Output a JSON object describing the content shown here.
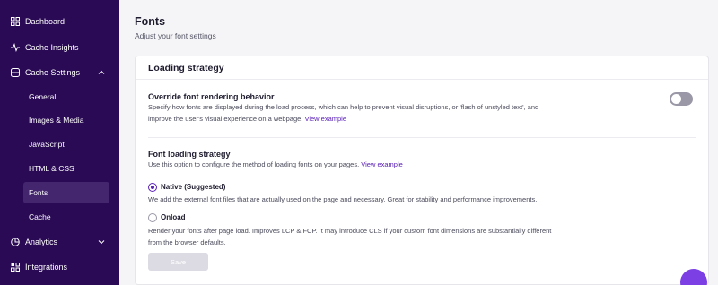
{
  "sidebar": {
    "items": [
      {
        "label": "Dashboard",
        "icon": "home-icon"
      },
      {
        "label": "Cache Insights",
        "icon": "activity-icon"
      },
      {
        "label": "Cache Settings",
        "icon": "database-icon",
        "expanded": true
      },
      {
        "label": "Analytics",
        "icon": "chart-icon",
        "expanded": false
      },
      {
        "label": "Integrations",
        "icon": "grid-icon"
      }
    ],
    "sub_items": [
      {
        "label": "General"
      },
      {
        "label": "Images & Media"
      },
      {
        "label": "JavaScript"
      },
      {
        "label": "HTML & CSS"
      },
      {
        "label": "Fonts",
        "active": true
      },
      {
        "label": "Cache"
      }
    ]
  },
  "header": {
    "title": "Fonts",
    "subtitle": "Adjust your font settings"
  },
  "card": {
    "title": "Loading strategy",
    "override": {
      "title": "Override font rendering behavior",
      "desc_line1": "Specify how fonts are displayed during the load process, which can help to prevent visual disruptions, or 'flash of unstyled text', and",
      "desc_line2": "improve the user's visual experience on a webpage.",
      "link": "View example",
      "toggle_on": false
    },
    "strategy": {
      "title": "Font loading strategy",
      "desc": "Use this option to configure the method of loading fonts on your pages.",
      "link": "View example",
      "options": [
        {
          "label": "Native (Suggested)",
          "checked": true,
          "desc_line1": "We add the external font files that are actually used on the page and necessary. Great for stability and performance improvements.",
          "desc_line2": ""
        },
        {
          "label": "Onload",
          "checked": false,
          "desc_line1": "Render your fonts after page load. Improves LCP & FCP. It may introduce CLS if your custom font dimensions are substantially different",
          "desc_line2": "from the browser defaults."
        }
      ]
    },
    "save_label": "Save"
  },
  "colors": {
    "sidebar_bg": "#2a0a55",
    "accent": "#5b21b6",
    "chat": "#7b3fe4"
  }
}
